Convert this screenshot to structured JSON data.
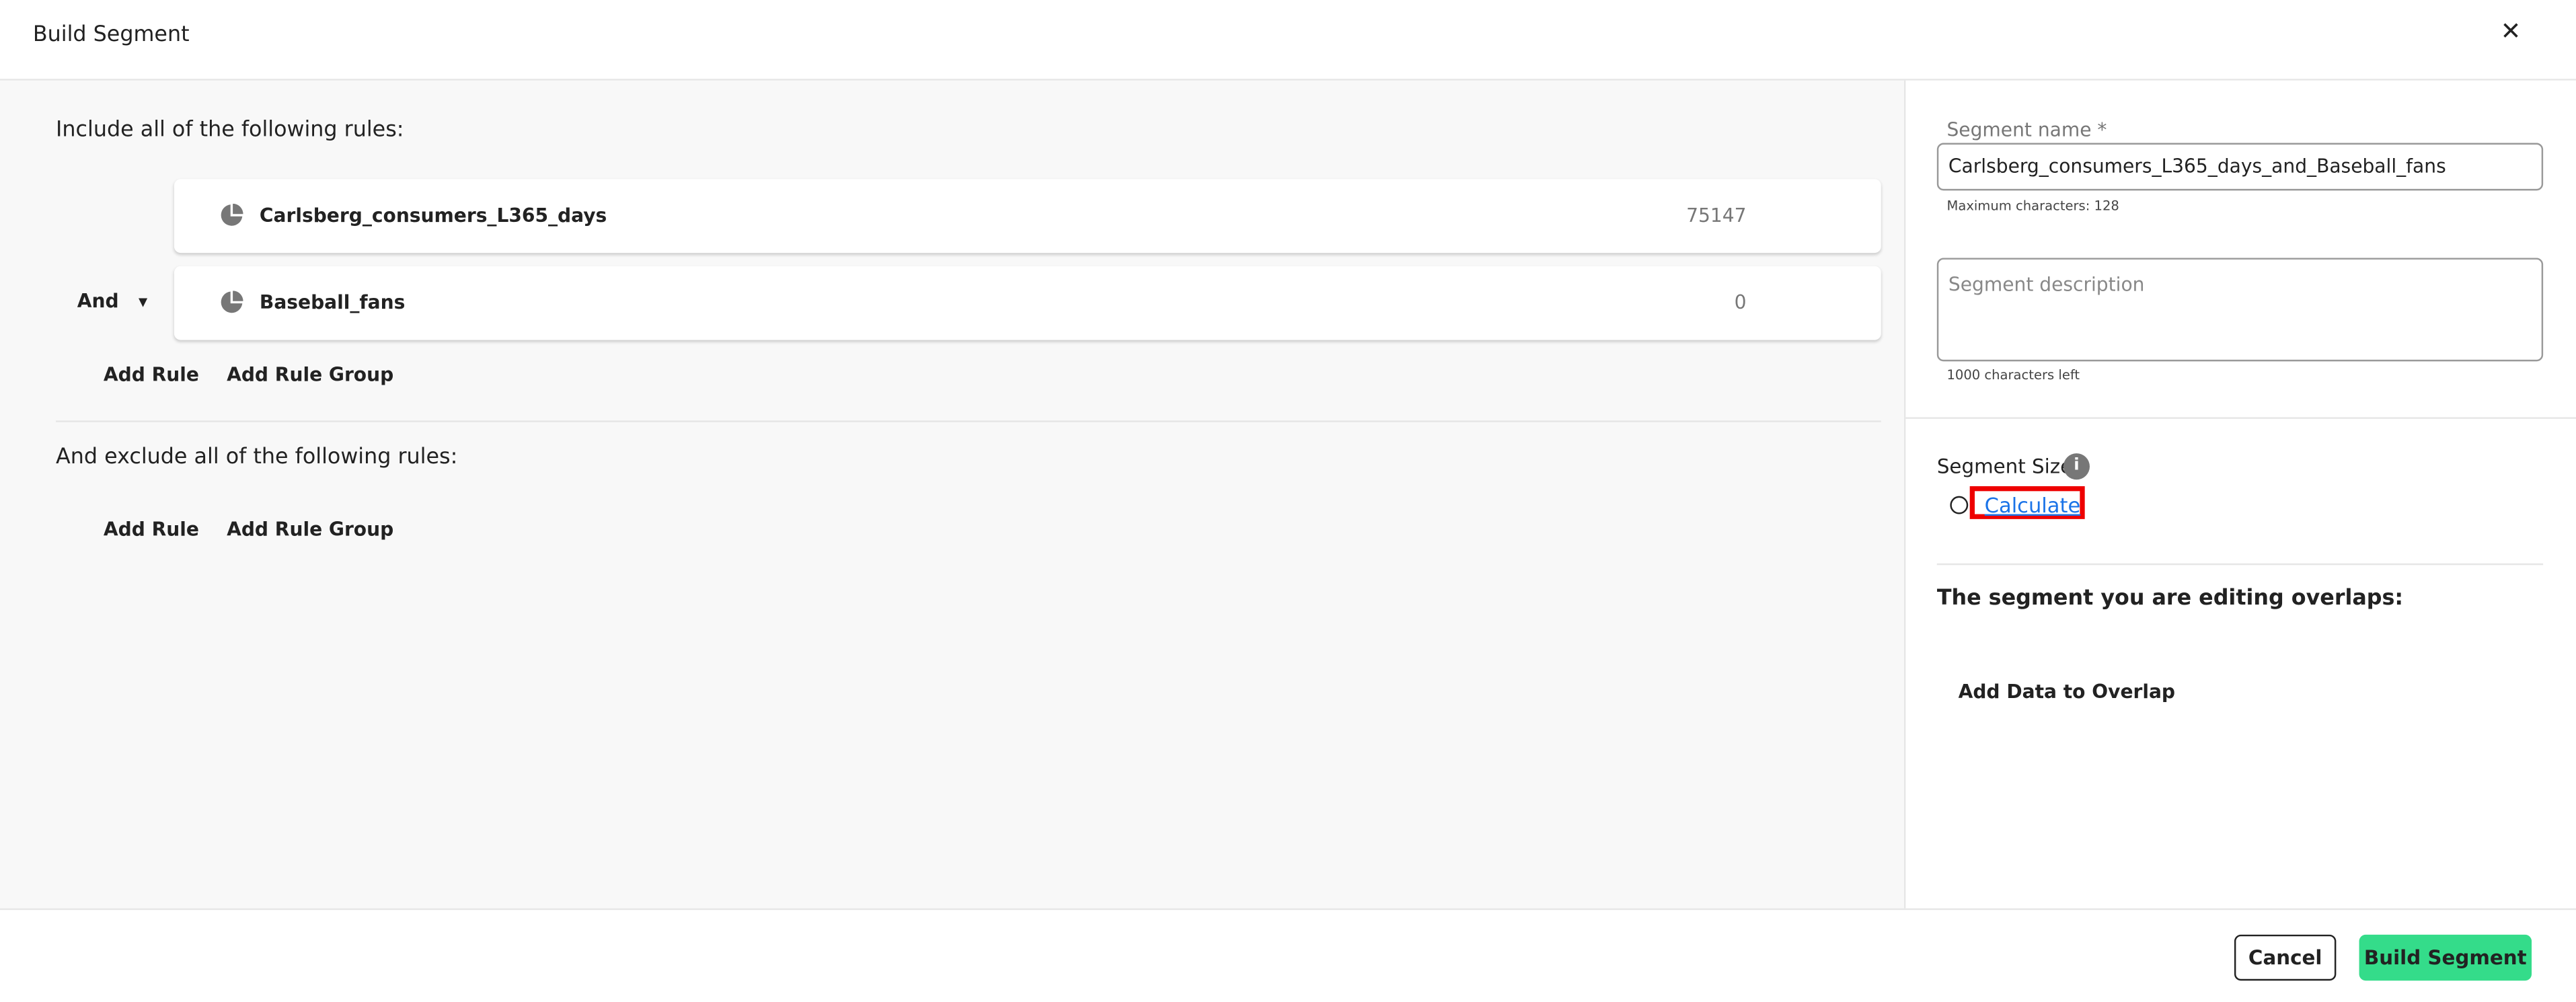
{
  "dialog": {
    "title": "Build Segment",
    "close_icon": "close-icon"
  },
  "include": {
    "heading": "Include all of the following rules:",
    "rules": [
      {
        "name": "Carlsberg_consumers_L365_days",
        "count": "75147",
        "icon": "pie-chart-icon"
      },
      {
        "operator": "And",
        "name": "Baseball_fans",
        "count": "0",
        "icon": "pie-chart-icon"
      }
    ],
    "add_rule": "Add Rule",
    "add_rule_group": "Add Rule Group"
  },
  "exclude": {
    "heading": "And exclude all of the following rules:",
    "add_rule": "Add Rule",
    "add_rule_group": "Add Rule Group"
  },
  "form": {
    "name_label": "Segment name *",
    "name_value": "Carlsberg_consumers_L365_days_and_Baseball_fans",
    "name_hint": "Maximum characters: 128",
    "description_placeholder": "Segment description",
    "description_hint": "1000 characters left",
    "size_label": "Segment Size",
    "calculate": "Calculate",
    "overlaps_heading": "The segment you are editing overlaps:",
    "add_overlap": "Add Data to Overlap"
  },
  "footer": {
    "cancel": "Cancel",
    "build": "Build Segment"
  },
  "colors": {
    "accent_green": "#34dc8a",
    "link_blue": "#1a73e8",
    "highlight_red": "#ee0000"
  }
}
